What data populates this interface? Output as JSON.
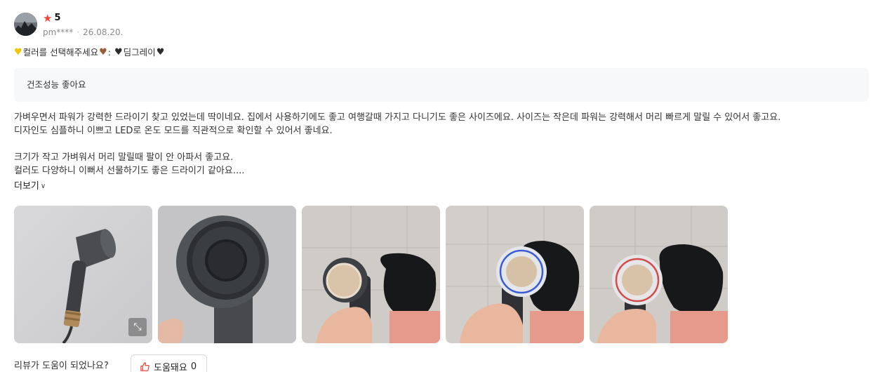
{
  "review": {
    "rating": "5",
    "star_icon": "star-icon",
    "user": "pm****",
    "separator": "·",
    "date": "26.08.20.",
    "option": {
      "prefix": "컬러를 선택해주세요",
      "colon": ":",
      "value": "딤그레이",
      "heart_icons": [
        "yellow-heart-icon",
        "brown-heart-icon",
        "black-heart-icon",
        "black-heart-icon"
      ]
    },
    "headline": "건조성능 좋아요",
    "body": [
      "가벼우면서 파워가 강력한 드라이기 찾고 있었는데 딱이네요. 집에서 사용하기에도 좋고 여행갈때 가지고 다니기도 좋은 사이즈에요. 사이즈는 작은데 파워는 강력해서 머리 빠르게 말릴 수 있어서 좋고요.",
      "디자인도 심플하니 이쁘고 LED로 온도 모드를 직관적으로 확인할 수 있어서 좋네요.",
      "",
      "크기가 작고 가벼워서 머리 말릴때 팔이 안 아파서 좋고요.",
      "컬러도 다양하니 이뻐서 선물하기도 좋은 드라이기 같아요...."
    ],
    "more_label": "더보기",
    "photos": [
      "hair-dryer-product-photo",
      "dryer-rear-fan-photo",
      "dryer-use-photo-1",
      "dryer-use-photo-2",
      "dryer-use-photo-3"
    ],
    "helpful_question": "리뷰가 도움이 되었나요?",
    "helpful_label": "도움돼요",
    "helpful_count": "0"
  },
  "colors": {
    "star": "#f04438",
    "headline_bg": "#f7f8fa",
    "thumb_icon": "#f04438"
  }
}
